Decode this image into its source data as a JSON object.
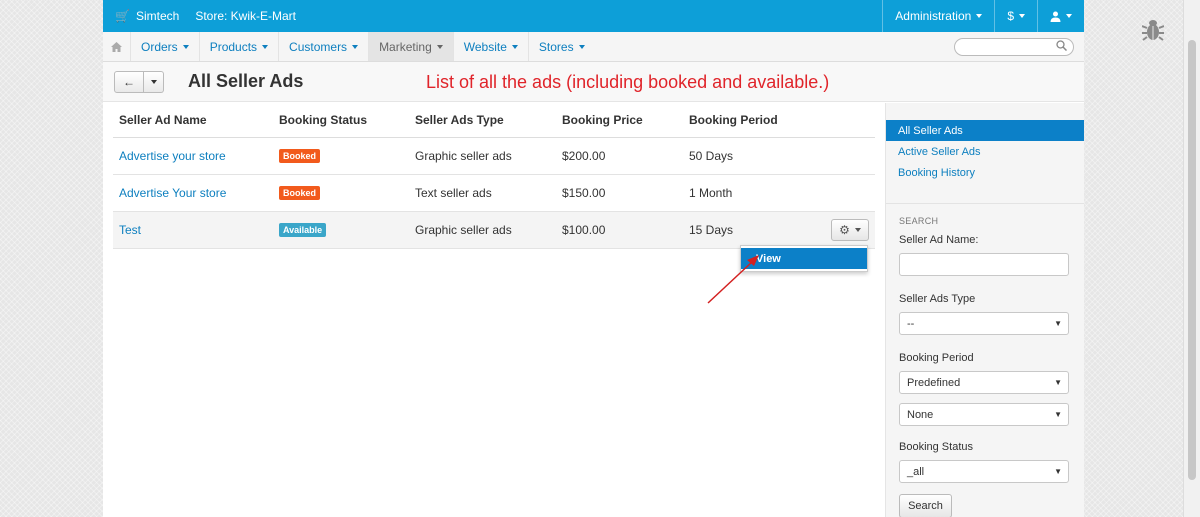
{
  "topbar": {
    "brand": "Simtech",
    "store": "Store: Kwik-E-Mart",
    "admin": "Administration",
    "currency": "$",
    "user_icon": "user-icon"
  },
  "nav": {
    "items": [
      "Orders",
      "Products",
      "Customers",
      "Marketing",
      "Website",
      "Stores"
    ],
    "active": "Marketing"
  },
  "page": {
    "title": "All Seller Ads",
    "annotation": "List of all the ads (including booked and available.)"
  },
  "table": {
    "headers": [
      "Seller Ad Name",
      "Booking Status",
      "Seller Ads Type",
      "Booking Price",
      "Booking Period"
    ],
    "rows": [
      {
        "name": "Advertise your store",
        "status": "Booked",
        "type": "Graphic seller ads",
        "price": "$200.00",
        "period": "50 Days"
      },
      {
        "name": "Advertise Your store",
        "status": "Booked",
        "type": "Text seller ads",
        "price": "$150.00",
        "period": "1 Month"
      },
      {
        "name": "Test",
        "status": "Available",
        "type": "Graphic seller ads",
        "price": "$100.00",
        "period": "15 Days"
      }
    ]
  },
  "dropdown": {
    "view_label": "View"
  },
  "sidebar": {
    "menu": [
      "All Seller Ads",
      "Active Seller Ads",
      "Booking History"
    ],
    "search_title": "SEARCH",
    "fields": {
      "name_label": "Seller Ad Name:",
      "type_label": "Seller Ads Type",
      "type_value": "--",
      "period_label": "Booking Period",
      "period_value": "Predefined",
      "period_value2": "None",
      "status_label": "Booking Status",
      "status_value": "_all"
    },
    "search_button": "Search"
  },
  "colors": {
    "topbar": "#0d9fd8",
    "booked": "#f25a1c",
    "available": "#3aa6c9",
    "accent": "#0c80c8",
    "annotation": "#e0242a"
  }
}
